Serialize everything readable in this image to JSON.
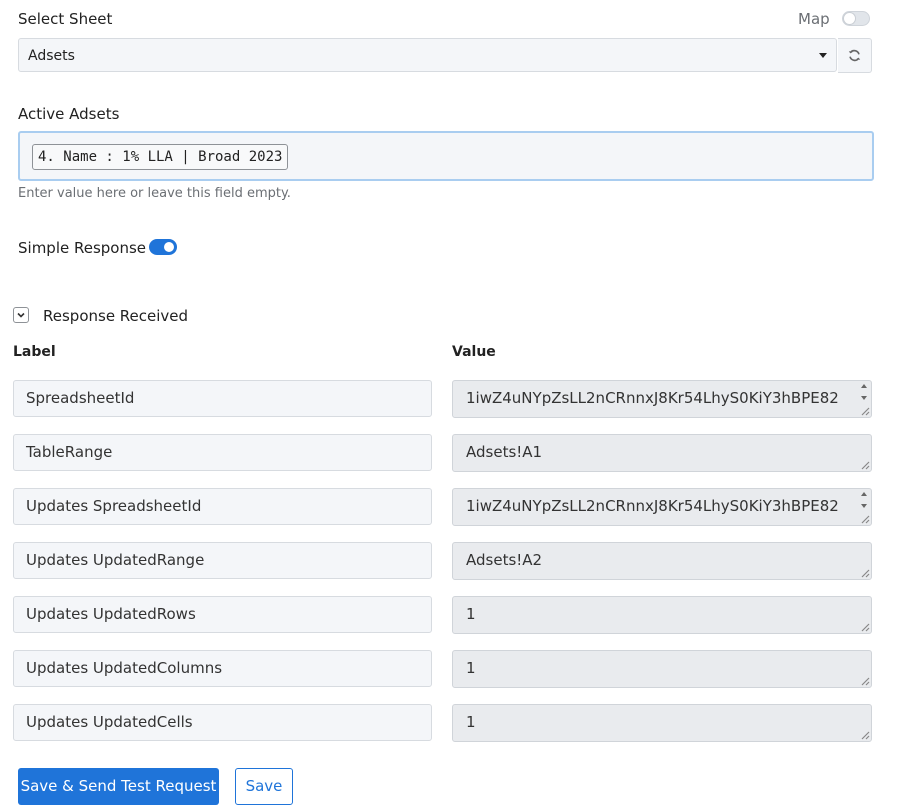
{
  "select_sheet": {
    "label": "Select Sheet",
    "map_label": "Map",
    "map_toggle_on": false,
    "selected": "Adsets"
  },
  "active_adsets": {
    "label": "Active Adsets",
    "chip": "4. Name : 1% LLA | Broad 2023",
    "helper": "Enter value here or leave this field empty."
  },
  "simple_response": {
    "label": "Simple Response",
    "enabled": true
  },
  "response": {
    "title": "Response Received",
    "col_label": "Label",
    "col_value": "Value",
    "rows": [
      {
        "label": "SpreadsheetId",
        "value": "1iwZ4uNYpZsLL2nCRnnxJ8Kr54LhyS0KiY3hBPE82"
      },
      {
        "label": "TableRange",
        "value": "Adsets!A1"
      },
      {
        "label": "Updates SpreadsheetId",
        "value": "1iwZ4uNYpZsLL2nCRnnxJ8Kr54LhyS0KiY3hBPE82"
      },
      {
        "label": "Updates UpdatedRange",
        "value": "Adsets!A2"
      },
      {
        "label": "Updates UpdatedRows",
        "value": "1"
      },
      {
        "label": "Updates UpdatedColumns",
        "value": "1"
      },
      {
        "label": "Updates UpdatedCells",
        "value": "1"
      }
    ]
  },
  "buttons": {
    "save_send": "Save & Send Test Request",
    "save": "Save"
  },
  "colors": {
    "primary": "#1f74d9",
    "field_bg": "#f4f6f9",
    "readonly_bg": "#e9ebee",
    "focus_border": "#a9cdf0"
  }
}
